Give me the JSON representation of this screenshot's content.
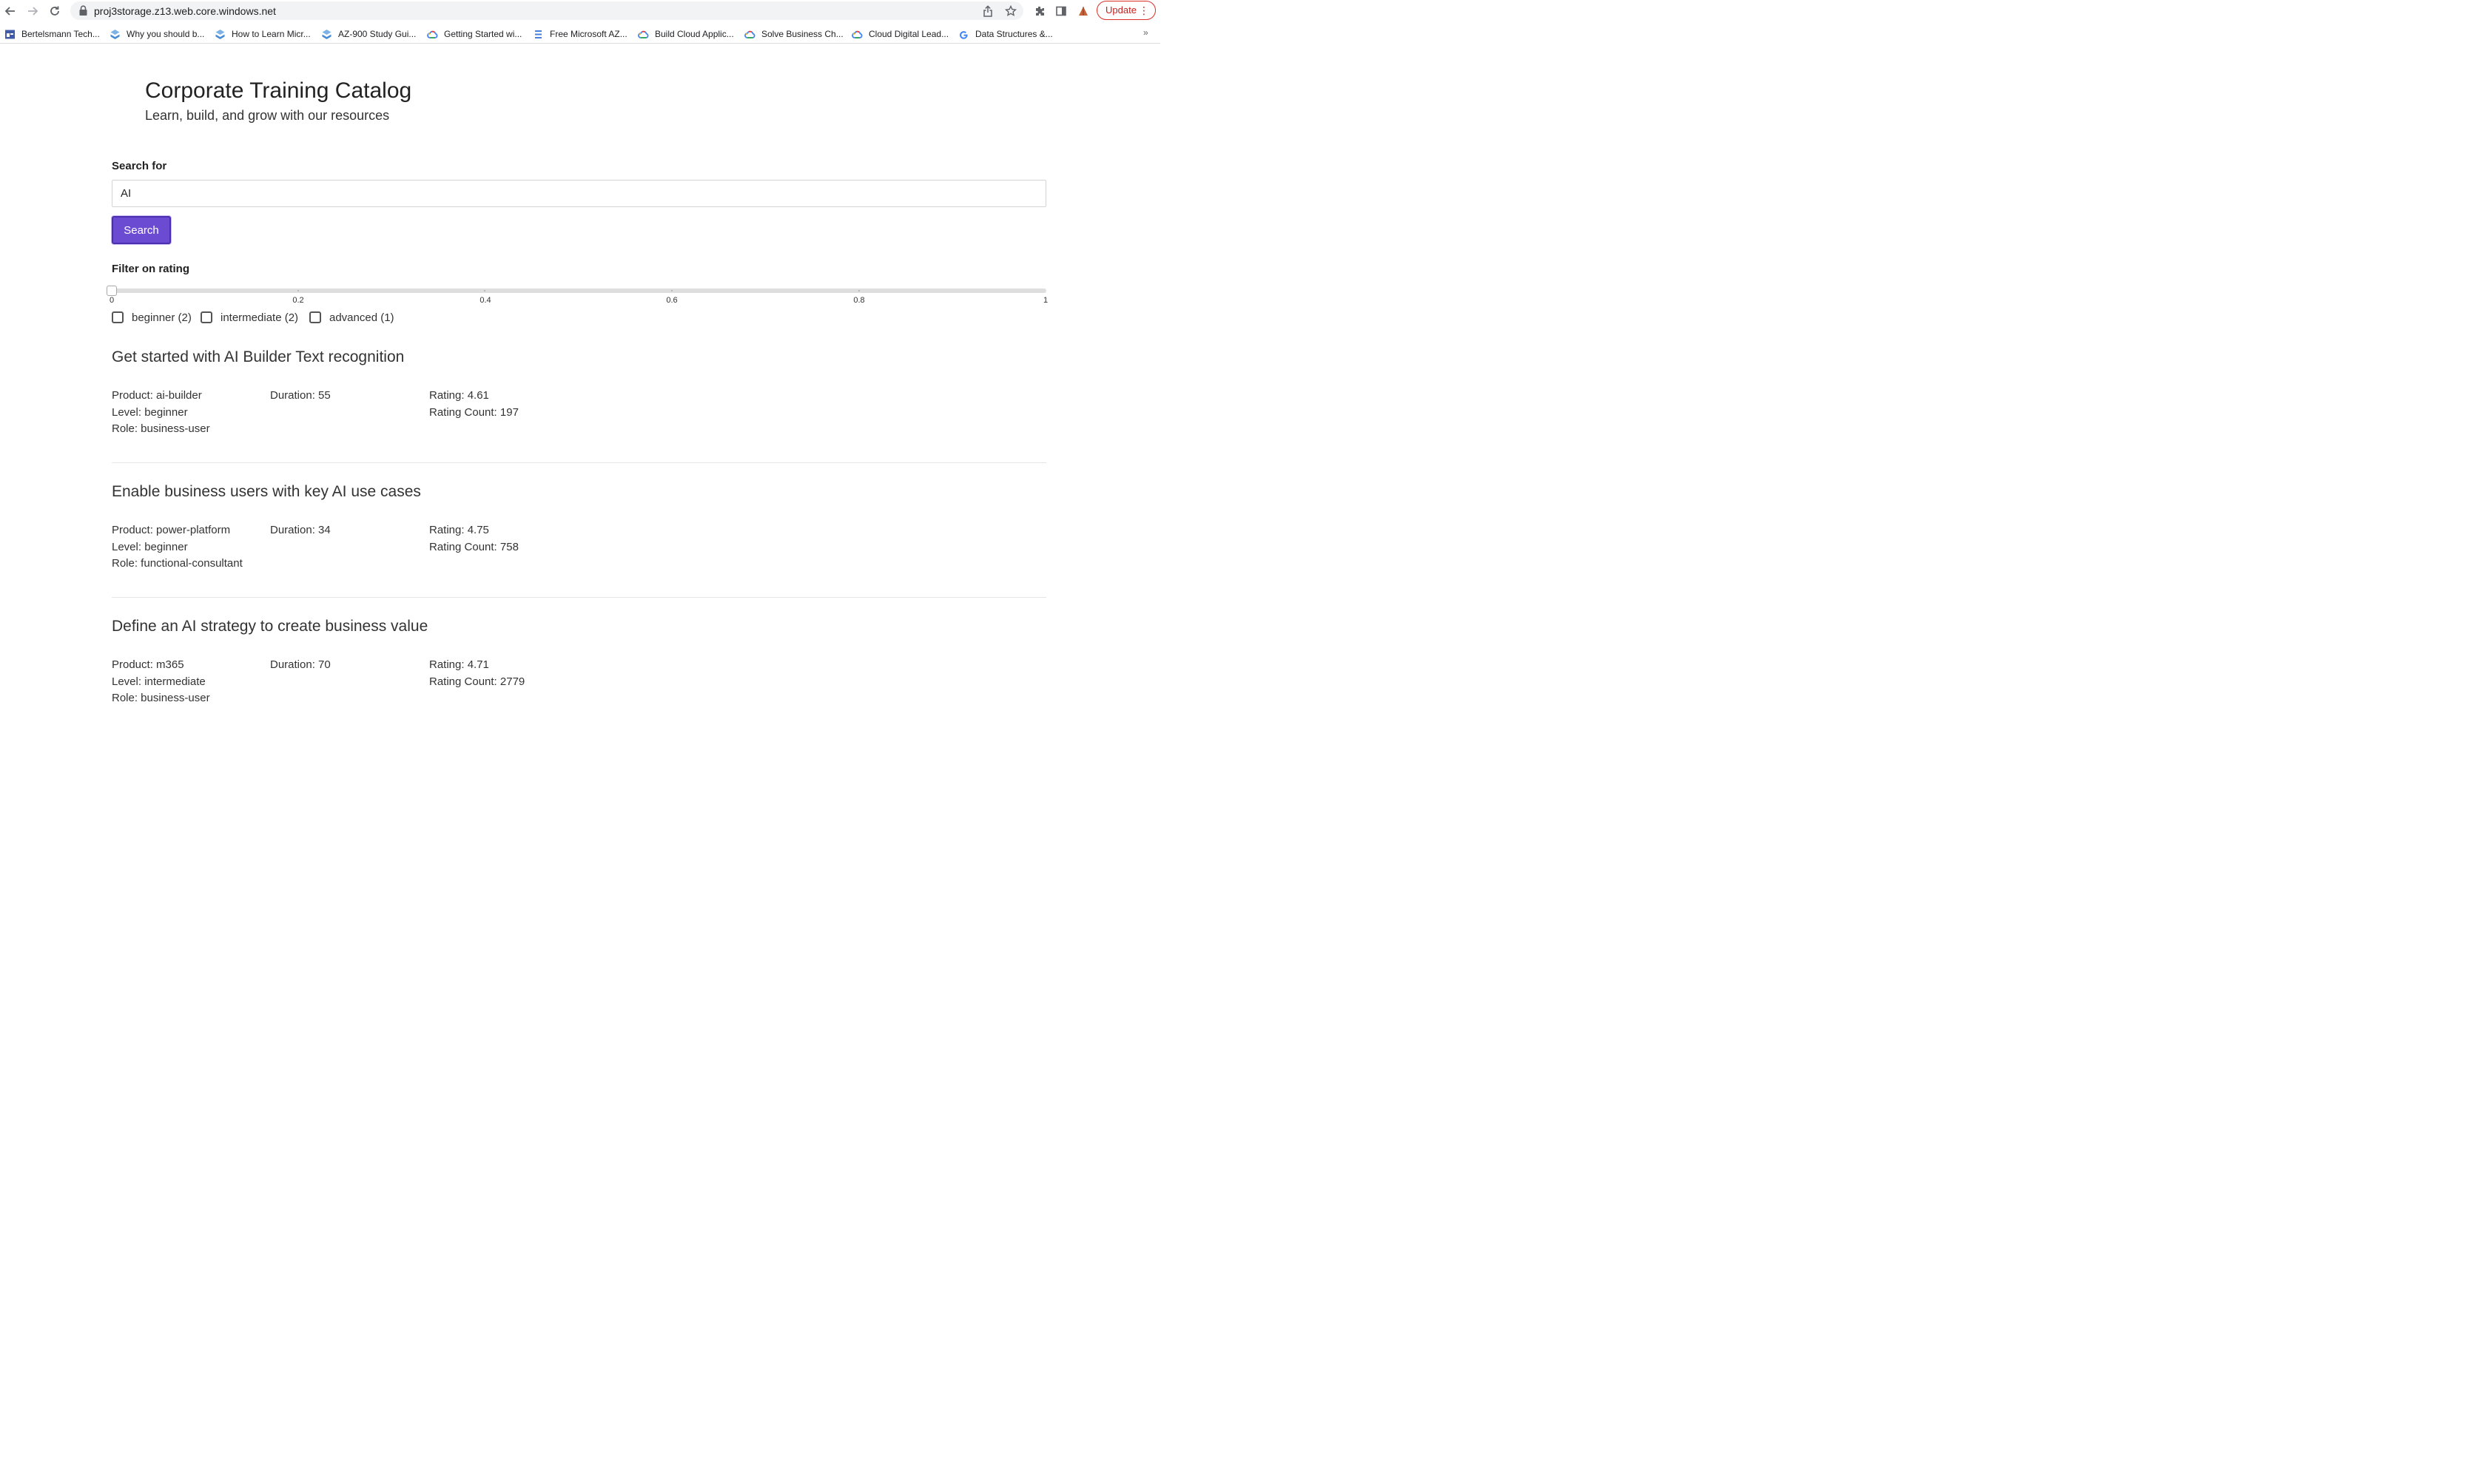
{
  "browser": {
    "url": "proj3storage.z13.web.core.windows.net",
    "update_label": "Update",
    "bookmarks": [
      {
        "label": "Bertelsmann Tech...",
        "icon": "calendar-icon"
      },
      {
        "label": "Why you should b...",
        "icon": "ms-learn-icon"
      },
      {
        "label": "How to Learn Micr...",
        "icon": "ms-learn-icon"
      },
      {
        "label": "AZ-900 Study Gui...",
        "icon": "ms-learn-icon"
      },
      {
        "label": "Getting Started wi...",
        "icon": "google-cloud-icon"
      },
      {
        "label": "Free Microsoft AZ...",
        "icon": "doc-lines-icon"
      },
      {
        "label": "Build Cloud Applic...",
        "icon": "google-cloud-icon"
      },
      {
        "label": "Solve Business Ch...",
        "icon": "google-cloud-icon"
      },
      {
        "label": "Cloud Digital Lead...",
        "icon": "google-cloud-icon"
      },
      {
        "label": "Data Structures &...",
        "icon": "google-g-icon"
      }
    ],
    "more_label": "»"
  },
  "header": {
    "title": "Corporate Training Catalog",
    "subtitle": "Learn, build, and grow with our resources"
  },
  "search": {
    "label": "Search for",
    "value": "AI",
    "button_label": "Search"
  },
  "filter": {
    "label": "Filter on rating",
    "slider_value": 0,
    "ticks": [
      "0",
      "0.2",
      "0.4",
      "0.6",
      "0.8",
      "1"
    ],
    "levels": [
      {
        "label": "beginner (2)",
        "checked": false
      },
      {
        "label": "intermediate (2)",
        "checked": false
      },
      {
        "label": "advanced (1)",
        "checked": false
      }
    ]
  },
  "results": [
    {
      "title": "Get started with AI Builder Text recognition",
      "product": "Product: ai-builder",
      "level": "Level: beginner",
      "role": "Role: business-user",
      "duration": "Duration: 55",
      "rating": "Rating: 4.61",
      "rating_count": "Rating Count: 197"
    },
    {
      "title": "Enable business users with key AI use cases",
      "product": "Product: power-platform",
      "level": "Level: beginner",
      "role": "Role: functional-consultant",
      "duration": "Duration: 34",
      "rating": "Rating: 4.75",
      "rating_count": "Rating Count: 758"
    },
    {
      "title": "Define an AI strategy to create business value",
      "product": "Product: m365",
      "level": "Level: intermediate",
      "role": "Role: business-user",
      "duration": "Duration: 70",
      "rating": "Rating: 4.71",
      "rating_count": "Rating Count: 2779"
    }
  ],
  "colors": {
    "accent": "#6c4bd3",
    "update_red": "#d93025"
  }
}
